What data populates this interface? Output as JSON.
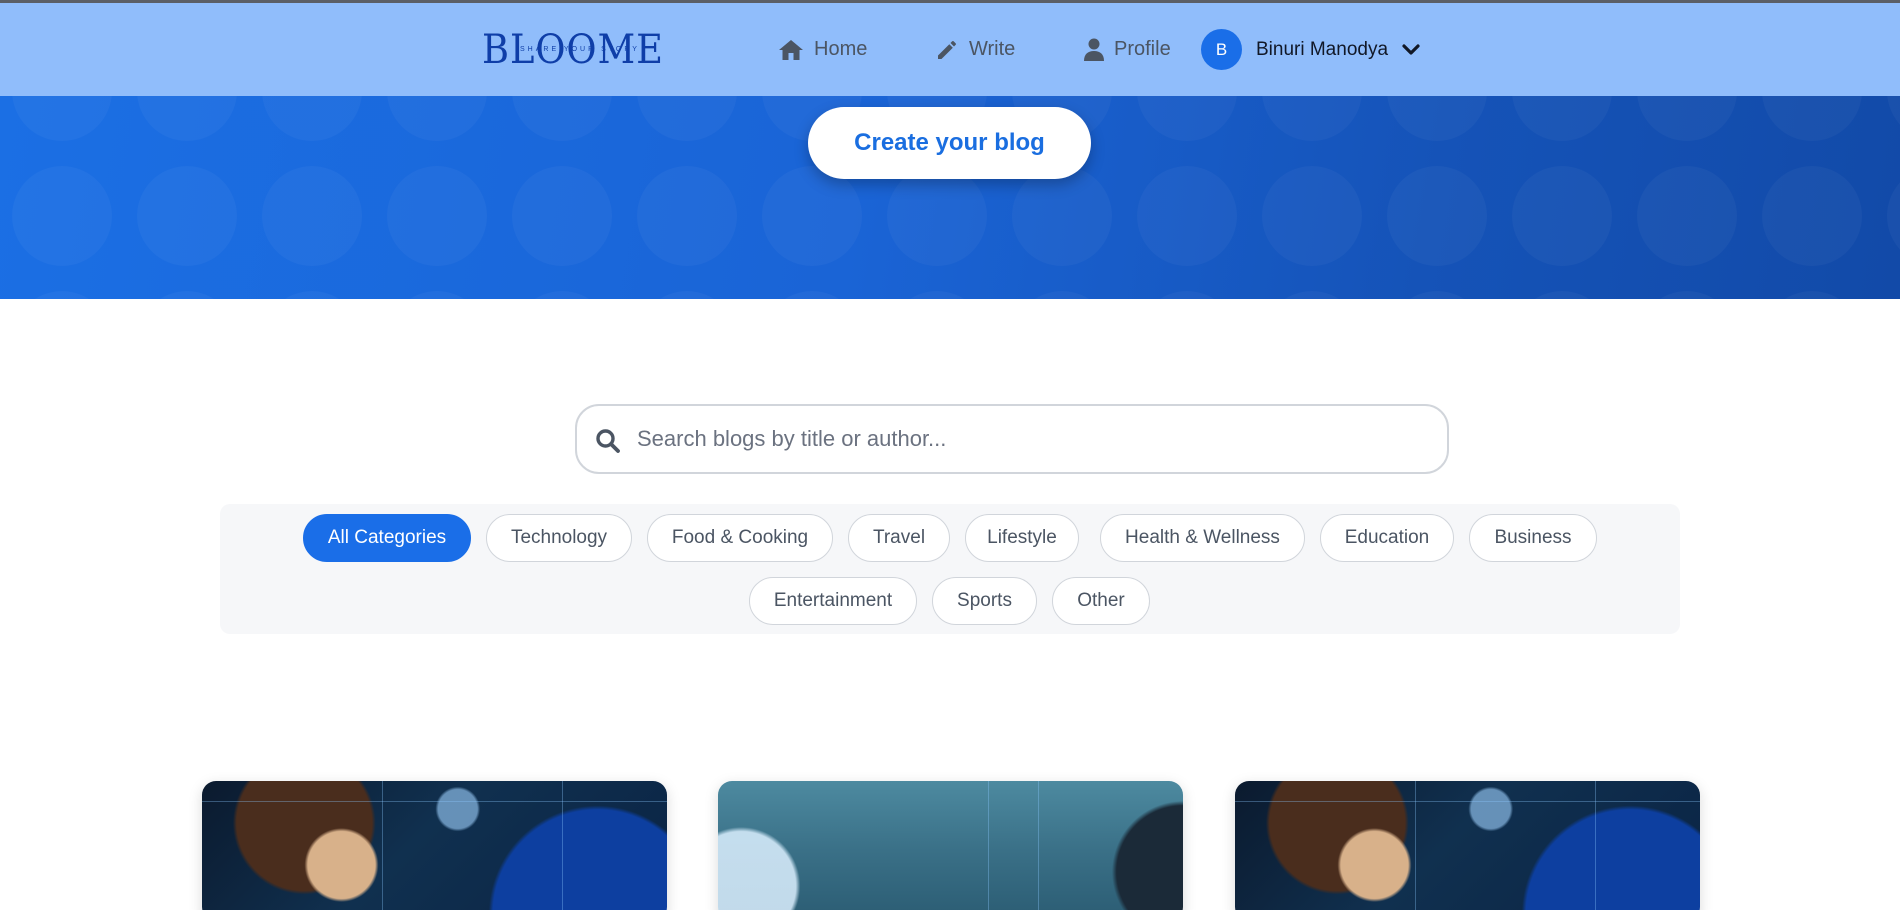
{
  "navbar": {
    "logo_text": "BLOOME",
    "logo_tagline": "SHARE YOUR STORY",
    "items": [
      {
        "label": "Home",
        "icon": "home-icon"
      },
      {
        "label": "Write",
        "icon": "pencil-icon"
      },
      {
        "label": "Profile",
        "icon": "user-icon"
      }
    ],
    "user": {
      "initial": "B",
      "name": "Binuri Manodya",
      "dropdown_icon": "chevron-down-icon"
    }
  },
  "hero": {
    "cta_label": "Create your blog"
  },
  "search": {
    "placeholder": "Search blogs by title or author...",
    "value": ""
  },
  "categories": {
    "selected": "All Categories",
    "items": [
      "All Categories",
      "Technology",
      "Food & Cooking",
      "Travel",
      "Lifestyle",
      "Health & Wellness",
      "Education",
      "Business",
      "Entertainment",
      "Sports",
      "Other"
    ]
  },
  "colors": {
    "nav_bg": "#90bdfb",
    "accent": "#1a6ee8",
    "hero_start": "#1b6fe4",
    "hero_end": "#124aa8"
  }
}
